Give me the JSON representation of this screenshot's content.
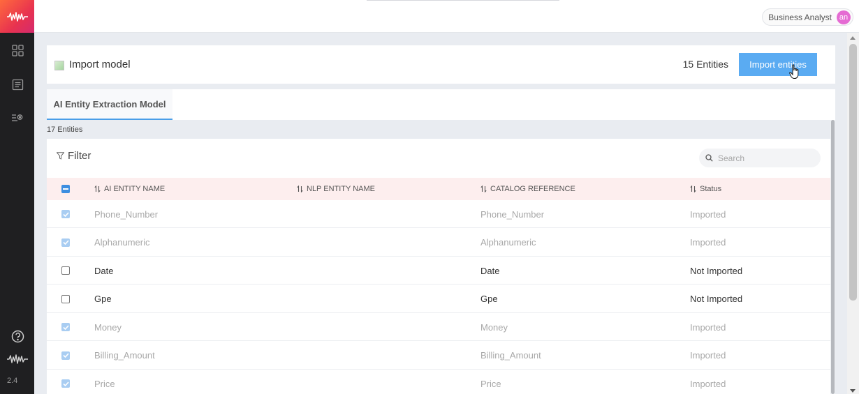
{
  "sidebar": {
    "icons": [
      "waveform-logo-icon",
      "grid-icon",
      "document-icon",
      "settings-list-icon",
      "help-icon",
      "waveform-icon"
    ],
    "version": "2.4"
  },
  "header": {
    "user_role": "Business Analyst",
    "avatar_initials": "an",
    "avatar_color": "#e56bd3"
  },
  "import_section": {
    "title": "Import model",
    "entities_count": "15 Entities",
    "import_button": "Import entities"
  },
  "tabs": [
    {
      "label": "AI Entity Extraction Model",
      "active": true
    }
  ],
  "entities_total": "17 Entities",
  "table": {
    "filter_label": "Filter",
    "search_placeholder": "Search",
    "columns": [
      "AI ENTITY NAME",
      "NLP ENTITY NAME",
      "CATALOG REFERENCE",
      "Status"
    ],
    "rows": [
      {
        "ai_name": "Phone_Number",
        "nlp_name": "",
        "catalog": "Phone_Number",
        "status": "Imported",
        "checked": true
      },
      {
        "ai_name": "Alphanumeric",
        "nlp_name": "",
        "catalog": "Alphanumeric",
        "status": "Imported",
        "checked": true
      },
      {
        "ai_name": "Date",
        "nlp_name": "",
        "catalog": "Date",
        "status": "Not Imported",
        "checked": false
      },
      {
        "ai_name": "Gpe",
        "nlp_name": "",
        "catalog": "Gpe",
        "status": "Not Imported",
        "checked": false
      },
      {
        "ai_name": "Money",
        "nlp_name": "",
        "catalog": "Money",
        "status": "Imported",
        "checked": true
      },
      {
        "ai_name": "Billing_Amount",
        "nlp_name": "",
        "catalog": "Billing_Amount",
        "status": "Imported",
        "checked": true
      },
      {
        "ai_name": "Price",
        "nlp_name": "",
        "catalog": "Price",
        "status": "Imported",
        "checked": true
      }
    ]
  },
  "colors": {
    "accent": "#5aabf2",
    "header_row_bg": "#fdeeee",
    "sidebar_bg": "#1f1f21"
  }
}
